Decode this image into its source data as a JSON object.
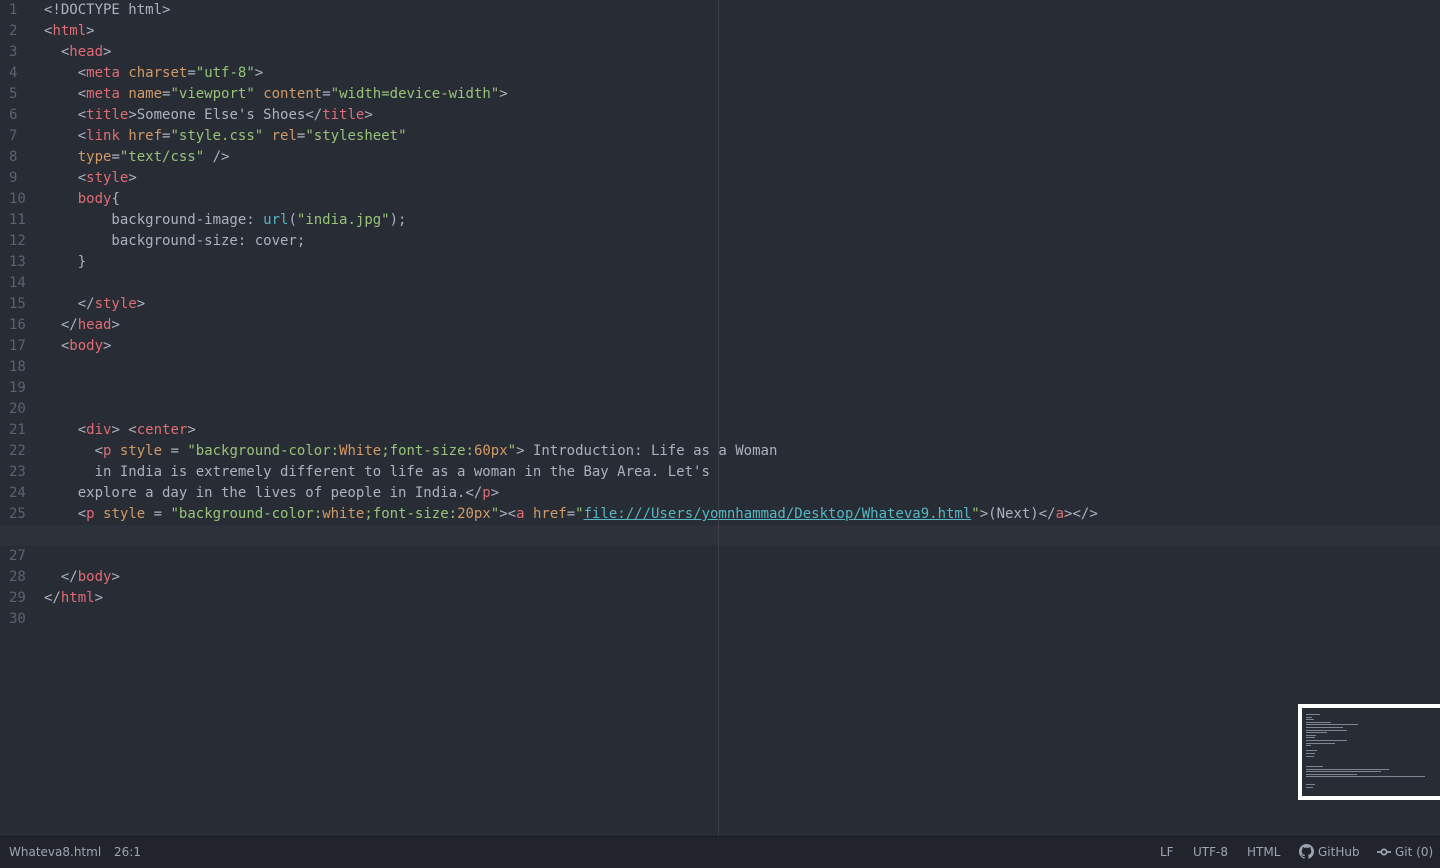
{
  "editor": {
    "current_line": 26,
    "lines": [
      [
        {
          "t": "<!DOCTYPE html>",
          "c": ""
        }
      ],
      [
        {
          "t": "<",
          "c": ""
        },
        {
          "t": "html",
          "c": "tag"
        },
        {
          "t": ">",
          "c": ""
        }
      ],
      [
        {
          "t": "  <",
          "c": ""
        },
        {
          "t": "head",
          "c": "tag"
        },
        {
          "t": ">",
          "c": ""
        }
      ],
      [
        {
          "t": "    <",
          "c": ""
        },
        {
          "t": "meta",
          "c": "tag"
        },
        {
          "t": " ",
          "c": ""
        },
        {
          "t": "charset",
          "c": "attr"
        },
        {
          "t": "=",
          "c": ""
        },
        {
          "t": "\"utf-8\"",
          "c": "str"
        },
        {
          "t": ">",
          "c": ""
        }
      ],
      [
        {
          "t": "    <",
          "c": ""
        },
        {
          "t": "meta",
          "c": "tag"
        },
        {
          "t": " ",
          "c": ""
        },
        {
          "t": "name",
          "c": "attr"
        },
        {
          "t": "=",
          "c": ""
        },
        {
          "t": "\"viewport\"",
          "c": "str"
        },
        {
          "t": " ",
          "c": ""
        },
        {
          "t": "content",
          "c": "attr"
        },
        {
          "t": "=",
          "c": ""
        },
        {
          "t": "\"width=device-width\"",
          "c": "str"
        },
        {
          "t": ">",
          "c": ""
        }
      ],
      [
        {
          "t": "    <",
          "c": ""
        },
        {
          "t": "title",
          "c": "tag"
        },
        {
          "t": ">Someone Else's Shoes</",
          "c": ""
        },
        {
          "t": "title",
          "c": "tag"
        },
        {
          "t": ">",
          "c": ""
        }
      ],
      [
        {
          "t": "    <",
          "c": ""
        },
        {
          "t": "link",
          "c": "tag"
        },
        {
          "t": " ",
          "c": ""
        },
        {
          "t": "href",
          "c": "attr"
        },
        {
          "t": "=",
          "c": ""
        },
        {
          "t": "\"style.css\"",
          "c": "str"
        },
        {
          "t": " ",
          "c": ""
        },
        {
          "t": "rel",
          "c": "attr"
        },
        {
          "t": "=",
          "c": ""
        },
        {
          "t": "\"stylesheet\"",
          "c": "str"
        }
      ],
      [
        {
          "t": "    ",
          "c": ""
        },
        {
          "t": "type",
          "c": "attr"
        },
        {
          "t": "=",
          "c": ""
        },
        {
          "t": "\"text/css\"",
          "c": "str"
        },
        {
          "t": " />",
          "c": ""
        }
      ],
      [
        {
          "t": "    <",
          "c": ""
        },
        {
          "t": "style",
          "c": "tag"
        },
        {
          "t": ">",
          "c": ""
        }
      ],
      [
        {
          "t": "    ",
          "c": ""
        },
        {
          "t": "body",
          "c": "tag"
        },
        {
          "t": "{",
          "c": ""
        }
      ],
      [
        {
          "t": "        background-image: ",
          "c": ""
        },
        {
          "t": "url",
          "c": "fn"
        },
        {
          "t": "(",
          "c": ""
        },
        {
          "t": "\"india.jpg\"",
          "c": "str"
        },
        {
          "t": ");",
          "c": ""
        }
      ],
      [
        {
          "t": "        background-size: cover;",
          "c": ""
        }
      ],
      [
        {
          "t": "    }",
          "c": ""
        }
      ],
      [],
      [
        {
          "t": "    </",
          "c": ""
        },
        {
          "t": "style",
          "c": "tag"
        },
        {
          "t": ">",
          "c": ""
        }
      ],
      [
        {
          "t": "  </",
          "c": ""
        },
        {
          "t": "head",
          "c": "tag"
        },
        {
          "t": ">",
          "c": ""
        }
      ],
      [
        {
          "t": "  <",
          "c": ""
        },
        {
          "t": "body",
          "c": "tag"
        },
        {
          "t": ">",
          "c": ""
        }
      ],
      [],
      [],
      [],
      [
        {
          "t": "    <",
          "c": ""
        },
        {
          "t": "div",
          "c": "tag"
        },
        {
          "t": "> <",
          "c": ""
        },
        {
          "t": "center",
          "c": "tag"
        },
        {
          "t": ">",
          "c": ""
        }
      ],
      [
        {
          "t": "      <",
          "c": ""
        },
        {
          "t": "p",
          "c": "tag"
        },
        {
          "t": " ",
          "c": ""
        },
        {
          "t": "style",
          "c": "attr"
        },
        {
          "t": " = ",
          "c": ""
        },
        {
          "t": "\"background-color:",
          "c": "str"
        },
        {
          "t": "White",
          "c": "attr"
        },
        {
          "t": ";font-size:",
          "c": "str"
        },
        {
          "t": "60px",
          "c": "attr"
        },
        {
          "t": "\"",
          "c": "str"
        },
        {
          "t": "> Introduction: Life as a Woman",
          "c": ""
        }
      ],
      [
        {
          "t": "      in India is extremely different to life as a woman in the Bay Area. Let's",
          "c": ""
        }
      ],
      [
        {
          "t": "    explore a day in the lives of people in India.</",
          "c": ""
        },
        {
          "t": "p",
          "c": "tag"
        },
        {
          "t": ">",
          "c": ""
        }
      ],
      [
        {
          "t": "    <",
          "c": ""
        },
        {
          "t": "p",
          "c": "tag"
        },
        {
          "t": " ",
          "c": ""
        },
        {
          "t": "style",
          "c": "attr"
        },
        {
          "t": " = ",
          "c": ""
        },
        {
          "t": "\"background-color:",
          "c": "str"
        },
        {
          "t": "white",
          "c": "attr"
        },
        {
          "t": ";font-size:",
          "c": "str"
        },
        {
          "t": "20px",
          "c": "attr"
        },
        {
          "t": "\"",
          "c": "str"
        },
        {
          "t": "><",
          "c": ""
        },
        {
          "t": "a",
          "c": "tag"
        },
        {
          "t": " ",
          "c": ""
        },
        {
          "t": "href",
          "c": "attr"
        },
        {
          "t": "=",
          "c": ""
        },
        {
          "t": "\"",
          "c": "str"
        },
        {
          "t": "file:///Users/yomnhammad/Desktop/Whateva9.html",
          "c": "link"
        },
        {
          "t": "\"",
          "c": "str"
        },
        {
          "t": ">(Next)</",
          "c": ""
        },
        {
          "t": "a",
          "c": "tag"
        },
        {
          "t": "></>",
          "c": ""
        }
      ],
      [],
      [],
      [
        {
          "t": "  </",
          "c": ""
        },
        {
          "t": "body",
          "c": "tag"
        },
        {
          "t": ">",
          "c": ""
        }
      ],
      [
        {
          "t": "</",
          "c": ""
        },
        {
          "t": "html",
          "c": "tag"
        },
        {
          "t": ">",
          "c": ""
        }
      ],
      []
    ]
  },
  "status_bar": {
    "file_name": "Whateva8.html",
    "cursor_position": "26:1",
    "line_ending": "LF",
    "encoding": "UTF-8",
    "grammar": "HTML",
    "github_label": "GitHub",
    "git_label": "Git (0)",
    "github_icon": "github-icon",
    "git_icon": "git-commit-icon"
  },
  "colors": {
    "background": "#282c34",
    "tag": "#e06c75",
    "attribute": "#d19a66",
    "string": "#98c379",
    "function": "#56b6c2",
    "text": "#abb2bf",
    "gutter_text": "#5c6370"
  }
}
